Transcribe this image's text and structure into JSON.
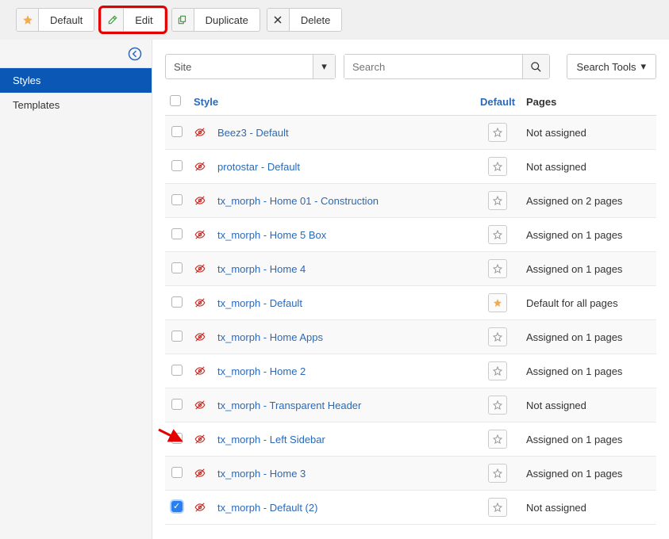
{
  "toolbar": {
    "default_label": "Default",
    "edit_label": "Edit",
    "duplicate_label": "Duplicate",
    "delete_label": "Delete"
  },
  "sidebar": {
    "items": [
      {
        "label": "Styles"
      },
      {
        "label": "Templates"
      }
    ]
  },
  "filters": {
    "site_value": "Site",
    "search_placeholder": "Search",
    "tools_label": "Search Tools"
  },
  "columns": {
    "style": "Style",
    "default": "Default",
    "pages": "Pages"
  },
  "rows": [
    {
      "name": "Beez3 - Default",
      "default": false,
      "pages": "Not assigned",
      "checked": false
    },
    {
      "name": "protostar - Default",
      "default": false,
      "pages": "Not assigned",
      "checked": false
    },
    {
      "name": "tx_morph - Home 01 - Construction",
      "default": false,
      "pages": "Assigned on 2 pages",
      "checked": false
    },
    {
      "name": "tx_morph - Home 5 Box",
      "default": false,
      "pages": "Assigned on 1 pages",
      "checked": false
    },
    {
      "name": "tx_morph - Home 4",
      "default": false,
      "pages": "Assigned on 1 pages",
      "checked": false
    },
    {
      "name": "tx_morph - Default",
      "default": true,
      "pages": "Default for all pages",
      "checked": false
    },
    {
      "name": "tx_morph - Home Apps",
      "default": false,
      "pages": "Assigned on 1 pages",
      "checked": false
    },
    {
      "name": "tx_morph - Home 2",
      "default": false,
      "pages": "Assigned on 1 pages",
      "checked": false
    },
    {
      "name": "tx_morph - Transparent Header",
      "default": false,
      "pages": "Not assigned",
      "checked": false
    },
    {
      "name": "tx_morph - Left Sidebar",
      "default": false,
      "pages": "Assigned on 1 pages",
      "checked": false
    },
    {
      "name": "tx_morph - Home 3",
      "default": false,
      "pages": "Assigned on 1 pages",
      "checked": false
    },
    {
      "name": "tx_morph - Default (2)",
      "default": false,
      "pages": "Not assigned",
      "checked": true
    }
  ]
}
